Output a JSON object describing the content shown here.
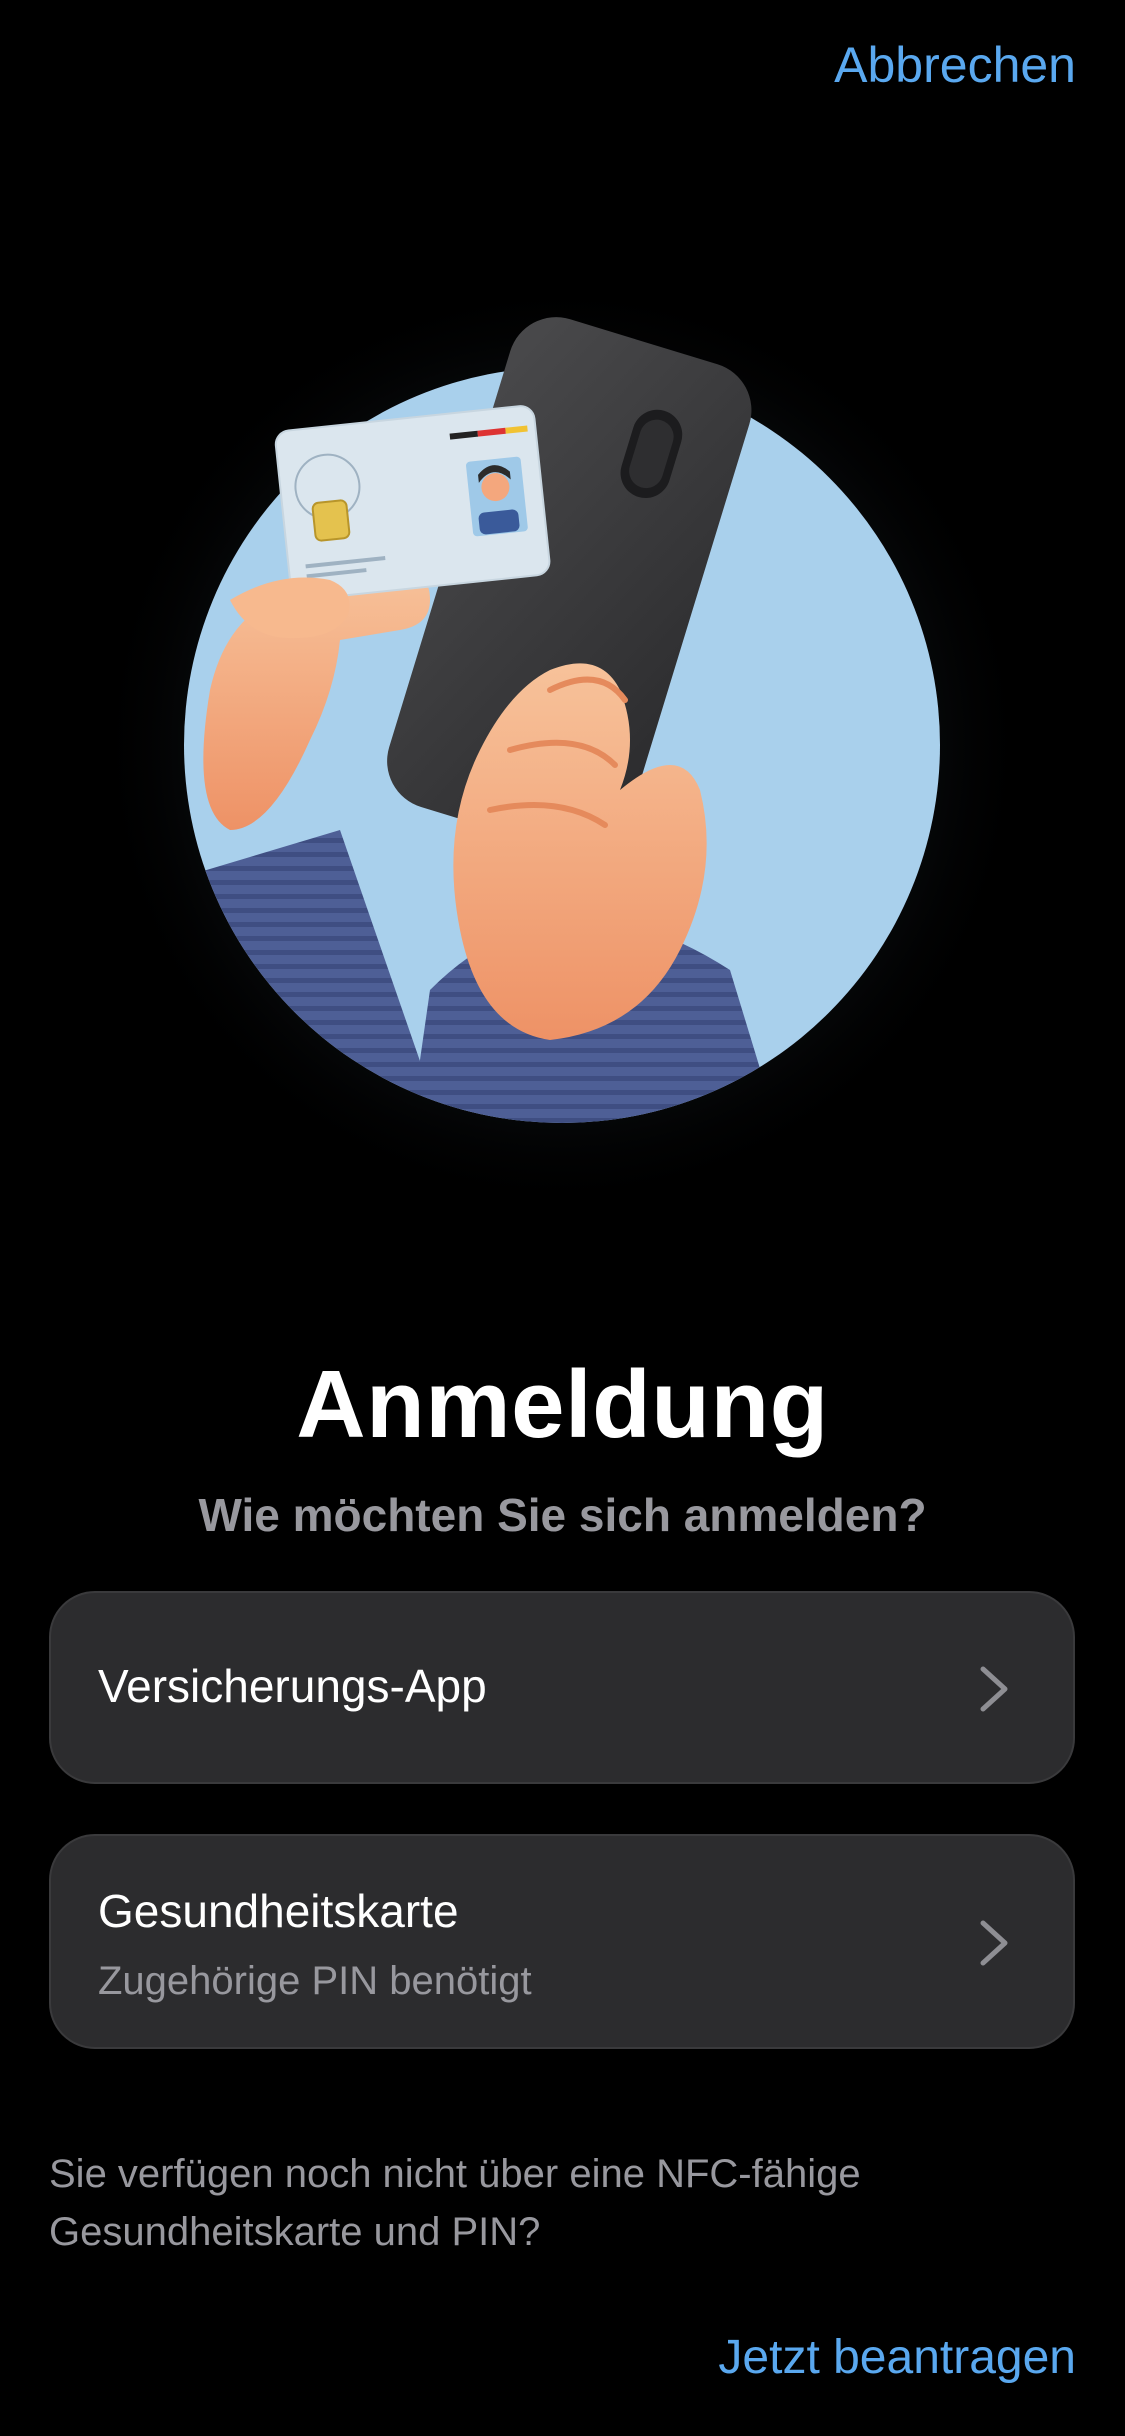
{
  "header": {
    "cancel_label": "Abbrechen"
  },
  "illustration": {
    "name": "hand holding id card and phone",
    "colors": {
      "background_circle": "#a9d0ec",
      "phone": "#3a3a3c",
      "skin": "#f4a77d",
      "sleeve": "#4e5f96",
      "card": "#dbe6ee",
      "chip": "#e4c24e"
    }
  },
  "main": {
    "title": "Anmeldung",
    "subtitle": "Wie möchten Sie sich anmelden?",
    "options": [
      {
        "label": "Versicherungs-App",
        "sublabel": "",
        "icon": "chevron-right-icon"
      },
      {
        "label": "Gesundheitskarte",
        "sublabel": "Zugehörige PIN benötigt",
        "icon": "chevron-right-icon"
      }
    ],
    "info_text": "Sie verfügen noch nicht über eine NFC-fähige Gesundheitskarte und PIN?",
    "apply_label": "Jetzt beantragen"
  },
  "colors": {
    "background": "#000000",
    "accent": "#5aa8ef",
    "card_background": "#2c2c2e",
    "secondary_text": "#98989e"
  }
}
